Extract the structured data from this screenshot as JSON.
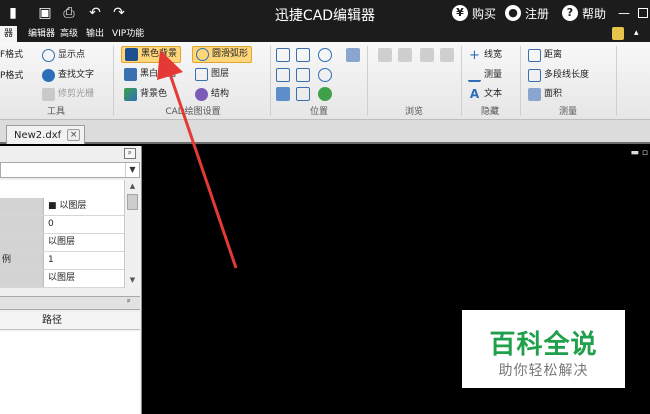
{
  "titlebar": {
    "title": "迅捷CAD编辑器",
    "buy": "购买",
    "register": "注册",
    "help": "帮助",
    "minimize": "—"
  },
  "ribbon_tabs": [
    "器",
    "编辑器",
    "高级",
    "输出",
    "VIP功能"
  ],
  "ribbon": {
    "tools": {
      "btn_f_format": "F格式",
      "btn_p_format": "P格式",
      "btn_show_point": "显示点",
      "btn_find_text": "查找文字",
      "btn_trim_light": "修剪光栅",
      "label": "工具"
    },
    "cad_settings": {
      "btn_black_bg": "黑色背景",
      "btn_black_white": "黑白绘图",
      "btn_bg_color": "背景色",
      "btn_smooth_arc": "圆滑弧形",
      "btn_layers": "图层",
      "btn_structure": "结构",
      "label": "CAD绘图设置"
    },
    "position": {
      "label": "位置"
    },
    "browse": {
      "label": "浏览"
    },
    "hide": {
      "btn_linewidth": "线宽",
      "btn_measure": "测量",
      "btn_text": "文本",
      "label": "隐藏"
    },
    "measure": {
      "btn_distance": "距离",
      "btn_polyline_length": "多段线长度",
      "btn_area": "面积",
      "label": "测量"
    }
  },
  "document_tab": {
    "name": "New2.dxf",
    "close": "×"
  },
  "left_panel": {
    "pin": "ᵖ",
    "properties": [
      {
        "key": "",
        "value": "■ 以图层"
      },
      {
        "key": "",
        "value": "0"
      },
      {
        "key": "",
        "value": "以图层"
      },
      {
        "key": "例",
        "value": "1"
      },
      {
        "key": "",
        "value": "以图层"
      }
    ],
    "panel2_pin": "ᵖ",
    "col_path": "路径"
  },
  "watermark": {
    "title": "百科全说",
    "subtitle": "助你轻松解决"
  },
  "colors": {
    "accent_green": "#1fa04a",
    "highlight": "#ffd77a",
    "arrow_red": "#e53935"
  }
}
